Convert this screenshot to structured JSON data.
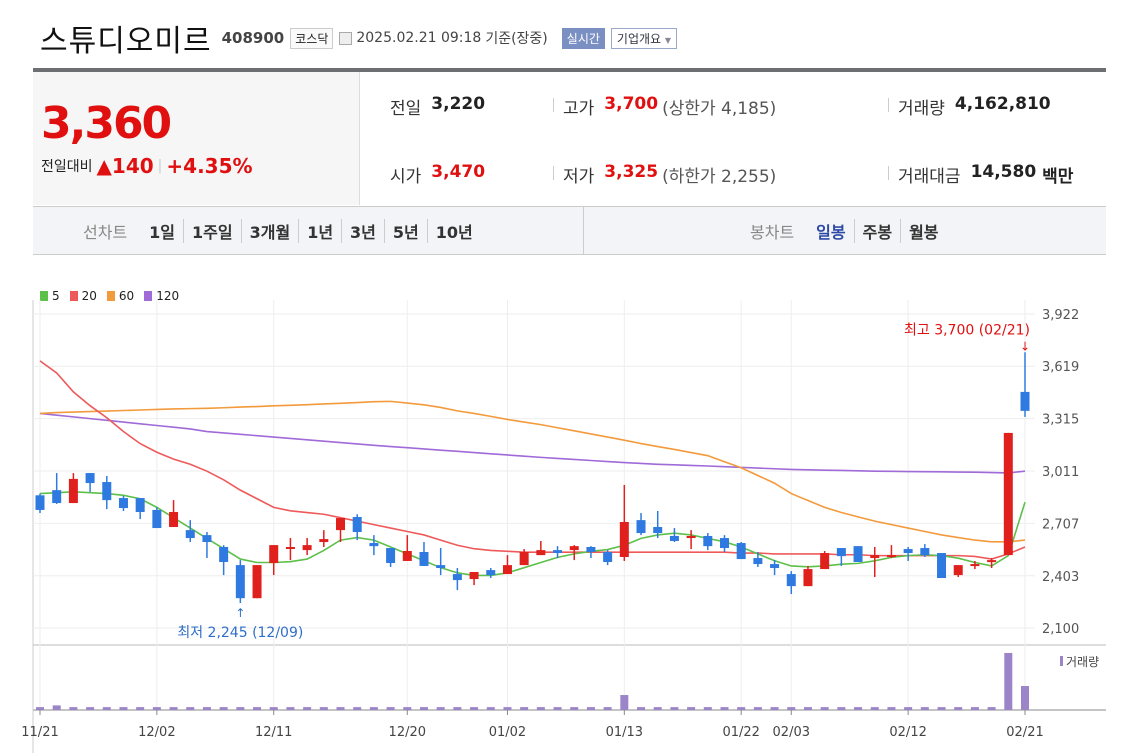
{
  "header": {
    "name": "스튜디오미르",
    "code": "408900",
    "market": "코스닥",
    "datetime": "2025.02.21 09:18",
    "basis": "기준(장중)",
    "realtime": "실시간",
    "company_overview": "기업개요"
  },
  "quote": {
    "price": "3,360",
    "change_label": "전일대비",
    "change": "140",
    "change_pct": "+4.35%",
    "prev_label": "전일",
    "prev": "3,220",
    "open_label": "시가",
    "open": "3,470",
    "high_label": "고가",
    "high": "3,700",
    "upper_limit": "(상한가 4,185)",
    "low_label": "저가",
    "low": "3,325",
    "lower_limit": "(하한가 2,255)",
    "volume_label": "거래량",
    "volume": "4,162,810",
    "value_label": "거래대금",
    "value": "14,580",
    "value_unit": "백만"
  },
  "period": {
    "line_label": "선차트",
    "line_items": [
      "1일",
      "1주일",
      "3개월",
      "1년",
      "3년",
      "5년",
      "10년"
    ],
    "candle_label": "봉차트",
    "candle_items": [
      "일봉",
      "주봉",
      "월봉"
    ],
    "selected_candle": "일봉"
  },
  "colors": {
    "up": "#e0201c",
    "down": "#2f7ae0",
    "ma5": "#5cc04a",
    "ma20": "#ee5a5a",
    "ma60": "#f39a3c",
    "ma120": "#a06ad8",
    "volume": "#9c84c9"
  },
  "chart_data": {
    "type": "candlestick",
    "legend": [
      "5",
      "20",
      "60",
      "120"
    ],
    "yticks": [
      3922,
      3619,
      3315,
      3011,
      2707,
      2403,
      2100
    ],
    "ylim": [
      2100,
      3922
    ],
    "xticks": [
      {
        "i": 0,
        "label": "11/21"
      },
      {
        "i": 7,
        "label": "12/02"
      },
      {
        "i": 14,
        "label": "12/11"
      },
      {
        "i": 22,
        "label": "12/20"
      },
      {
        "i": 28,
        "label": "01/02"
      },
      {
        "i": 35,
        "label": "01/13"
      },
      {
        "i": 42,
        "label": "01/22"
      },
      {
        "i": 45,
        "label": "02/03"
      },
      {
        "i": 52,
        "label": "02/12"
      },
      {
        "i": 59,
        "label": "02/21"
      }
    ],
    "ohlc": [
      [
        2870,
        2880,
        2767,
        2785
      ],
      [
        2900,
        2999,
        2820,
        2825
      ],
      [
        2825,
        2999,
        2825,
        2965
      ],
      [
        2999,
        2999,
        2890,
        2941
      ],
      [
        2947,
        2982,
        2790,
        2842
      ],
      [
        2854,
        2866,
        2779,
        2796
      ],
      [
        2854,
        2854,
        2732,
        2773
      ],
      [
        2785,
        2800,
        2680,
        2680
      ],
      [
        2686,
        2842,
        2686,
        2773
      ],
      [
        2668,
        2726,
        2599,
        2622
      ],
      [
        2639,
        2657,
        2506,
        2599
      ],
      [
        2570,
        2581,
        2407,
        2483
      ],
      [
        2465,
        2494,
        2245,
        2273
      ],
      [
        2273,
        2465,
        2273,
        2465
      ],
      [
        2477,
        2581,
        2407,
        2581
      ],
      [
        2562,
        2622,
        2494,
        2570
      ],
      [
        2552,
        2622,
        2523,
        2581
      ],
      [
        2599,
        2668,
        2570,
        2616
      ],
      [
        2668,
        2738,
        2599,
        2738
      ],
      [
        2744,
        2760,
        2610,
        2657
      ],
      [
        2593,
        2639,
        2523,
        2575
      ],
      [
        2564,
        2564,
        2454,
        2477
      ],
      [
        2489,
        2639,
        2489,
        2547
      ],
      [
        2541,
        2599,
        2460,
        2460
      ],
      [
        2465,
        2564,
        2407,
        2448
      ],
      [
        2413,
        2448,
        2320,
        2378
      ],
      [
        2384,
        2425,
        2349,
        2425
      ],
      [
        2436,
        2448,
        2390,
        2407
      ],
      [
        2413,
        2523,
        2413,
        2465
      ],
      [
        2465,
        2558,
        2465,
        2541
      ],
      [
        2523,
        2605,
        2523,
        2552
      ],
      [
        2552,
        2575,
        2506,
        2535
      ],
      [
        2552,
        2581,
        2494,
        2575
      ],
      [
        2570,
        2575,
        2506,
        2541
      ],
      [
        2541,
        2552,
        2465,
        2483
      ],
      [
        2512,
        2930,
        2489,
        2715
      ],
      [
        2726,
        2767,
        2639,
        2651
      ],
      [
        2686,
        2779,
        2622,
        2651
      ],
      [
        2634,
        2680,
        2599,
        2605
      ],
      [
        2622,
        2668,
        2558,
        2634
      ],
      [
        2634,
        2651,
        2552,
        2575
      ],
      [
        2622,
        2639,
        2541,
        2564
      ],
      [
        2593,
        2599,
        2500,
        2500
      ],
      [
        2506,
        2541,
        2454,
        2471
      ],
      [
        2471,
        2494,
        2407,
        2448
      ],
      [
        2413,
        2430,
        2297,
        2343
      ],
      [
        2343,
        2460,
        2343,
        2442
      ],
      [
        2442,
        2547,
        2442,
        2535
      ],
      [
        2564,
        2564,
        2460,
        2517
      ],
      [
        2575,
        2575,
        2483,
        2483
      ],
      [
        2506,
        2570,
        2396,
        2523
      ],
      [
        2512,
        2581,
        2506,
        2523
      ],
      [
        2558,
        2570,
        2489,
        2535
      ],
      [
        2564,
        2587,
        2512,
        2523
      ],
      [
        2535,
        2535,
        2390,
        2390
      ],
      [
        2407,
        2465,
        2396,
        2465
      ],
      [
        2460,
        2489,
        2442,
        2471
      ],
      [
        2483,
        2506,
        2448,
        2494
      ],
      [
        2523,
        3232,
        2523,
        3232
      ],
      [
        3470,
        3700,
        3325,
        3360
      ]
    ],
    "ma5": [
      2880,
      2885,
      2890,
      2885,
      2880,
      2870,
      2850,
      2800,
      2740,
      2680,
      2620,
      2560,
      2500,
      2480,
      2480,
      2485,
      2500,
      2550,
      2610,
      2625,
      2610,
      2570,
      2530,
      2490,
      2450,
      2420,
      2405,
      2405,
      2420,
      2450,
      2480,
      2510,
      2530,
      2545,
      2555,
      2580,
      2620,
      2640,
      2650,
      2640,
      2620,
      2600,
      2570,
      2530,
      2490,
      2460,
      2455,
      2460,
      2470,
      2475,
      2490,
      2510,
      2520,
      2525,
      2520,
      2505,
      2480,
      2460,
      2520,
      2830
    ],
    "ma20": [
      3650,
      3580,
      3470,
      3390,
      3320,
      3240,
      3170,
      3120,
      3080,
      3050,
      3010,
      2960,
      2900,
      2850,
      2800,
      2780,
      2770,
      2760,
      2740,
      2720,
      2700,
      2680,
      2660,
      2640,
      2610,
      2580,
      2560,
      2550,
      2545,
      2540,
      2540,
      2540,
      2540,
      2540,
      2540,
      2540,
      2540,
      2540,
      2540,
      2540,
      2540,
      2540,
      2535,
      2535,
      2530,
      2530,
      2530,
      2530,
      2525,
      2525,
      2520,
      2520,
      2520,
      2520,
      2520,
      2520,
      2515,
      2500,
      2530,
      2570
    ],
    "ma60": [
      3345,
      3350,
      3353,
      3356,
      3359,
      3362,
      3365,
      3368,
      3371,
      3373,
      3375,
      3378,
      3382,
      3385,
      3389,
      3392,
      3396,
      3400,
      3404,
      3408,
      3413,
      3415,
      3405,
      3395,
      3380,
      3360,
      3345,
      3328,
      3310,
      3295,
      3280,
      3262,
      3244,
      3226,
      3208,
      3190,
      3170,
      3153,
      3136,
      3118,
      3100,
      3065,
      3030,
      2985,
      2940,
      2880,
      2840,
      2800,
      2770,
      2745,
      2720,
      2700,
      2680,
      2660,
      2640,
      2625,
      2610,
      2600,
      2600,
      2610
    ],
    "ma120": [
      3345,
      3335,
      3325,
      3315,
      3305,
      3295,
      3285,
      3275,
      3265,
      3255,
      3240,
      3232,
      3224,
      3216,
      3208,
      3200,
      3192,
      3184,
      3176,
      3168,
      3160,
      3153,
      3146,
      3139,
      3132,
      3125,
      3118,
      3111,
      3104,
      3097,
      3090,
      3084,
      3078,
      3072,
      3066,
      3060,
      3055,
      3050,
      3047,
      3043,
      3040,
      3036,
      3032,
      3028,
      3024,
      3020,
      3018,
      3016,
      3014,
      3012,
      3010,
      3009,
      3008,
      3007,
      3006,
      3005,
      3004,
      3002,
      3000,
      3010
    ],
    "volume": [
      500000,
      800000,
      500000,
      500000,
      500000,
      500000,
      500000,
      500000,
      500000,
      500000,
      500000,
      500000,
      500000,
      500000,
      500000,
      500000,
      500000,
      500000,
      500000,
      500000,
      500000,
      500000,
      500000,
      500000,
      500000,
      500000,
      500000,
      500000,
      500000,
      500000,
      500000,
      500000,
      500000,
      500000,
      500000,
      2600000,
      500000,
      500000,
      500000,
      500000,
      500000,
      500000,
      500000,
      500000,
      500000,
      500000,
      500000,
      500000,
      500000,
      500000,
      500000,
      500000,
      500000,
      500000,
      500000,
      500000,
      500000,
      500000,
      9900000,
      4162810
    ],
    "volume_label": "거래량",
    "annotations": {
      "high": "최고 3,700 (02/21)",
      "low": "최저 2,245 (12/09)"
    }
  }
}
